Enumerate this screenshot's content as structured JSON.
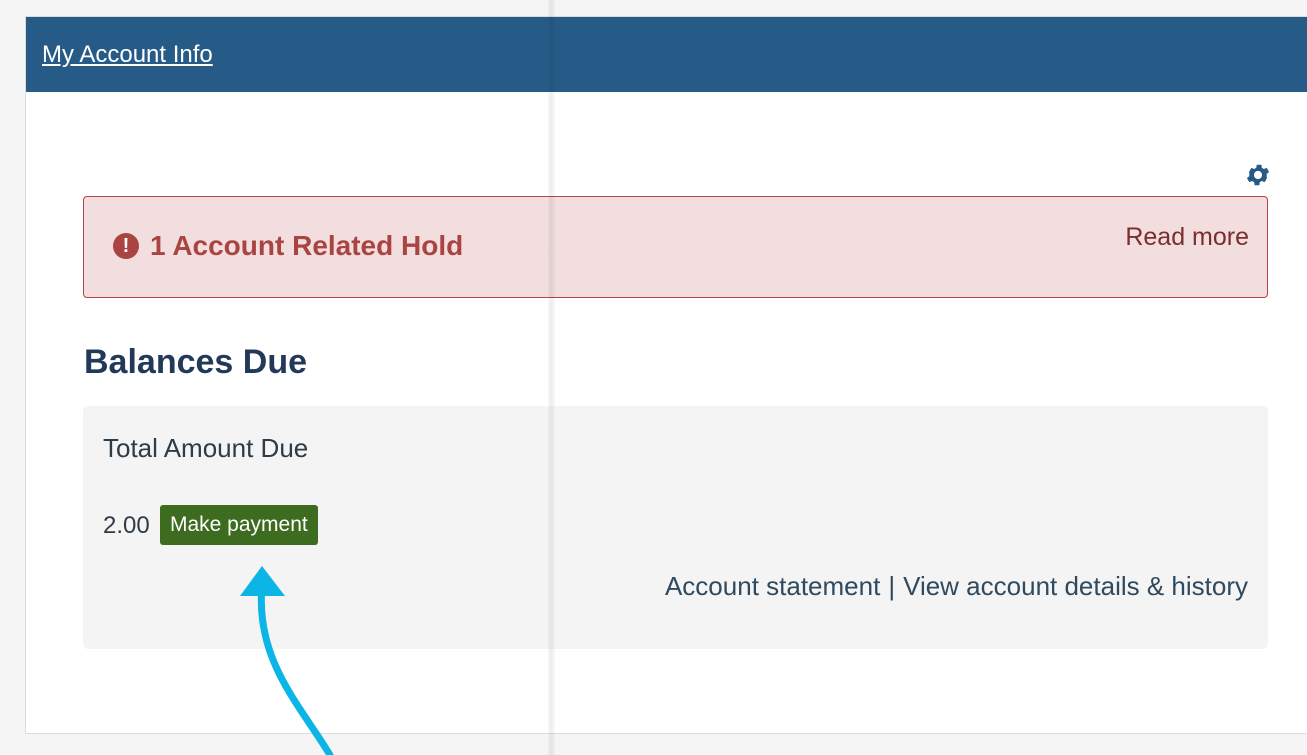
{
  "panel": {
    "title": "My Account Info"
  },
  "settings": {
    "icon": "gear-icon"
  },
  "alert": {
    "icon": "exclamation-circle-icon",
    "title": "1 Account Related Hold",
    "link": "Read more",
    "color": "#a94442",
    "background": "#f2dede"
  },
  "balances": {
    "heading": "Balances Due",
    "total_label": "Total Amount Due",
    "amount": "2.00",
    "pay_button": "Make payment",
    "links": {
      "statement": "Account statement",
      "separator": "|",
      "details": "View account details & history"
    }
  },
  "colors": {
    "header": "#265b87",
    "pay_button": "#3d6b1f",
    "annotation_arrow": "#0bb5e6"
  }
}
